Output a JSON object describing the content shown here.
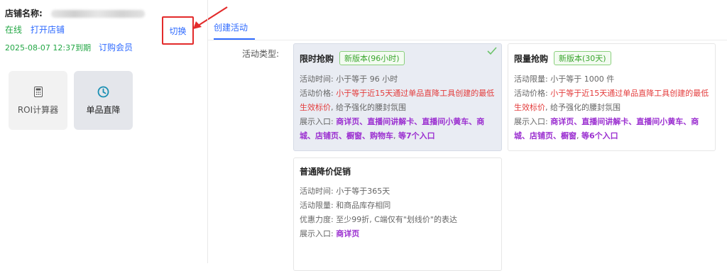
{
  "sidebar": {
    "store_name_label": "店铺名称:",
    "status": "在线",
    "open_store": "打开店铺",
    "expire_text": "2025-08-07 12:37到期",
    "subscribe": "订购会员",
    "switch_label": "切换",
    "tools": [
      {
        "label": "ROI计算器",
        "icon": "calculator-icon"
      },
      {
        "label": "单品直降",
        "icon": "clock-icon"
      }
    ]
  },
  "main": {
    "tab": "创建活动",
    "type_label": "活动类型:",
    "cards": [
      {
        "title": "限时抢购",
        "badge": "新版本(96小时)",
        "selected": true,
        "row1": "活动时间: 小于等于 96 小时",
        "price_prefix": "活动价格: ",
        "price_red": "小于等于近15天通过单品直降工具创建的最低生效标价",
        "price_suffix": ", 给予强化的腰封氛围",
        "entry_prefix": "展示入口: ",
        "entry_purple": "商详页、直播间讲解卡、直播间小黄车、商城、店铺页、橱窗、购物车",
        "entry_sep": ", ",
        "entry_count": "等7个入口"
      },
      {
        "title": "限量抢购",
        "badge": "新版本(30天)",
        "selected": false,
        "row1": "活动限量: 小于等于 1000 件",
        "price_prefix": "活动价格: ",
        "price_red": "小于等于近15天通过单品直降工具创建的最低生效标价",
        "price_suffix": ", 给予强化的腰封氛围",
        "entry_prefix": "展示入口: ",
        "entry_purple": "商详页、直播间讲解卡、直播间小黄车、商城、店铺页、橱窗",
        "entry_sep": ", ",
        "entry_count": "等6个入口"
      },
      {
        "title": "普通降价促销",
        "row1": "活动时间: 小于等于365天",
        "row2": "活动限量: 和商品库存相同",
        "row3": "优惠力度: 至少99折, C端仅有\"划线价\"的表达",
        "entry_prefix": "展示入口: ",
        "entry_purple": "商详页"
      }
    ]
  },
  "colors": {
    "accent": "#2f6bff",
    "online": "#23a745",
    "highlight_red": "#e33b3b",
    "entry_purple": "#9b2fd0",
    "annotation_red": "#e32b2b"
  }
}
